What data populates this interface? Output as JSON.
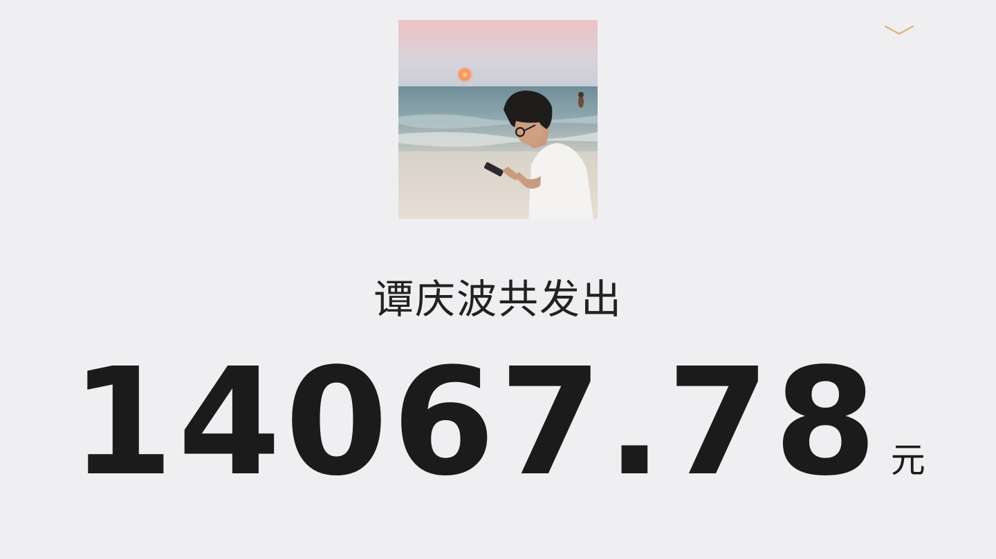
{
  "header": {
    "collapse_icon": "chevron-down-icon",
    "accent_color": "#d9b37a"
  },
  "profile": {
    "avatar_icon": "profile-photo-beach"
  },
  "summary": {
    "title": "谭庆波共发出",
    "amount": "14067.78",
    "currency": "元"
  }
}
